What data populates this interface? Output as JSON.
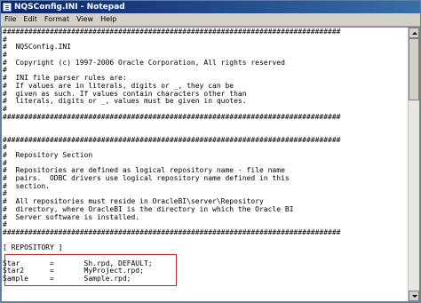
{
  "window": {
    "title": "NQSConfig.INI - Notepad",
    "app_icon": "notepad-icon"
  },
  "menu": [
    "File",
    "Edit",
    "Format",
    "View",
    "Help"
  ],
  "editor": {
    "lines": [
      "###############################################################################",
      "#",
      "#  NQSConfig.INI",
      "#",
      "#  Copyright (c) 1997-2006 Oracle Corporation, All rights reserved",
      "#",
      "#  INI file parser rules are:",
      "#  If values are in literals, digits or _, they can be",
      "#  given as such. If values contain characters other than",
      "#  literals, digits or _, values must be given in quotes.",
      "#",
      "###############################################################################",
      "",
      "",
      "###############################################################################",
      "#",
      "#  Repository Section",
      "#",
      "#  Repositories are defined as logical repository name - file name",
      "#  pairs.  ODBC drivers use logical repository name defined in this",
      "#  section.",
      "#",
      "#  All repositories must reside in OracleBI\\server\\Repository",
      "#  directory, where OracleBI is the directory in which the Oracle BI",
      "#  Server software is installed.",
      "#",
      "###############################################################################",
      "",
      "[ REPOSITORY ]",
      "",
      "Star       =       Sh.rpd, DEFAULT;",
      "Star2      =       MyProject.rpd;",
      "Sample     =       Sample.rpd;",
      ""
    ]
  }
}
